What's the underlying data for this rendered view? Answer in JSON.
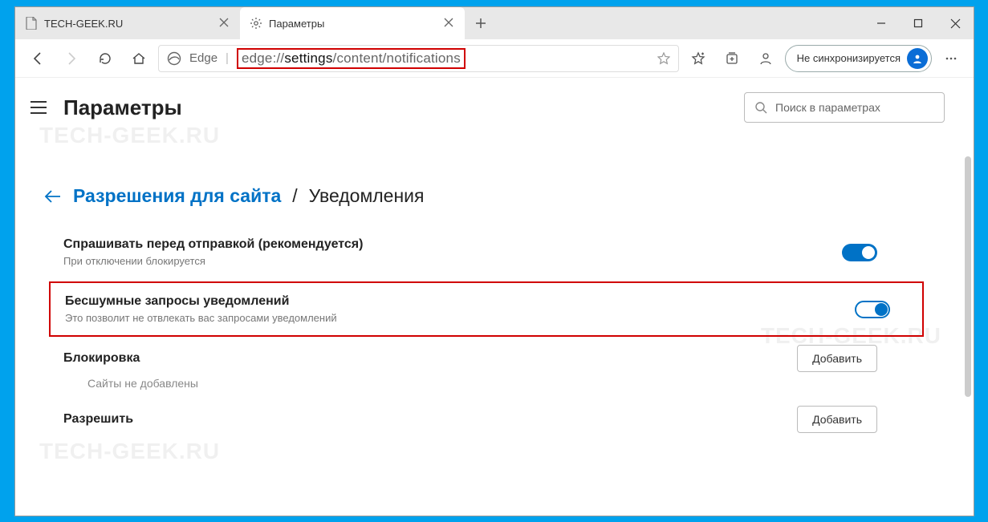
{
  "watermark": "TECH-GEEK.RU",
  "tabs": [
    {
      "label": "TECH-GEEK.RU",
      "active": false
    },
    {
      "label": "Параметры",
      "active": true
    }
  ],
  "toolbar": {
    "edge_label": "Edge",
    "url_prefix": "edge://",
    "url_strong": "settings",
    "url_suffix": "/content/notifications"
  },
  "profile": {
    "label": "Не синхронизируется"
  },
  "settings": {
    "title": "Параметры",
    "search_placeholder": "Поиск в параметрах",
    "breadcrumb": {
      "link": "Разрешения для сайта",
      "sep": "/",
      "current": "Уведомления"
    },
    "rows": {
      "ask": {
        "title": "Спрашивать перед отправкой (рекомендуется)",
        "sub": "При отключении блокируется"
      },
      "quiet": {
        "title": "Бесшумные запросы уведомлений",
        "sub": "Это позволит не отвлекать вас запросами уведомлений"
      },
      "block": {
        "title": "Блокировка",
        "empty": "Сайты не добавлены",
        "add": "Добавить"
      },
      "allow": {
        "title": "Разрешить",
        "add": "Добавить"
      }
    }
  }
}
